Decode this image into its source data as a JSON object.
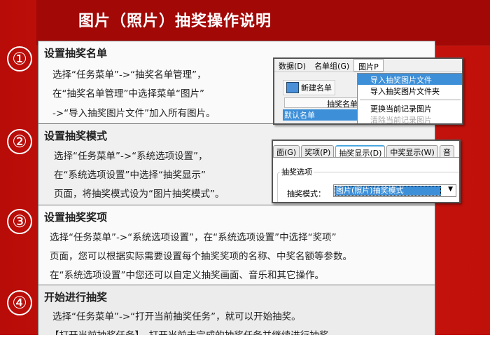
{
  "title": "图片（照片）抽奖操作说明",
  "steps": [
    {
      "num": "①",
      "heading": "设置抽奖名单",
      "lines": [
        "选择“任务菜单”->“抽奖名单管理”，",
        "在“抽奖名单管理”中选择菜单“图片”",
        "->“导入抽奖图片文件”加入所有图片。"
      ]
    },
    {
      "num": "②",
      "heading": "设置抽奖模式",
      "lines": [
        "选择“任务菜单”->“系统选项设置”，",
        "在“系统选项设置”中选择“抽奖显示”",
        "页面，将抽奖模式设为“图片抽奖模式”。"
      ]
    },
    {
      "num": "③",
      "heading": "设置抽奖奖项",
      "lines": [
        "选择“任务菜单”->“系统选项设置”，在“系统选项设置”中选择“奖项”",
        "页面，您可以根据实际需要设置每个抽奖奖项的名称、中奖名额等参数。",
        "在“系统选项设置”中您还可以自定义抽奖画面、音乐和其它操作。"
      ]
    },
    {
      "num": "④",
      "heading": "开始进行抽奖",
      "lines": [
        "选择“任务菜单”->“打开当前抽奖任务”，就可以开始抽奖。",
        "【打开当前抽奖任务】，打开当前未完成的抽奖任务并继续进行抽奖。"
      ]
    }
  ],
  "shot1": {
    "menus": [
      "数据(D)",
      "名单组(G)",
      "图片P"
    ],
    "new_list": "新建名单",
    "column": "抽奖名单",
    "row": "默认名单",
    "dropdown": [
      "导入抽奖图片文件",
      "导入抽奖图片文件夹",
      "更换当前记录图片",
      "清除当前记录图片"
    ]
  },
  "shot2": {
    "tabs": [
      "面(G)",
      "奖项(P)",
      "抽奖显示(D)",
      "中奖显示(W)",
      "音"
    ],
    "group": "抽奖选项",
    "field_label": "抽奖模式：",
    "field_value": "图片(照片)抽奖模式"
  }
}
